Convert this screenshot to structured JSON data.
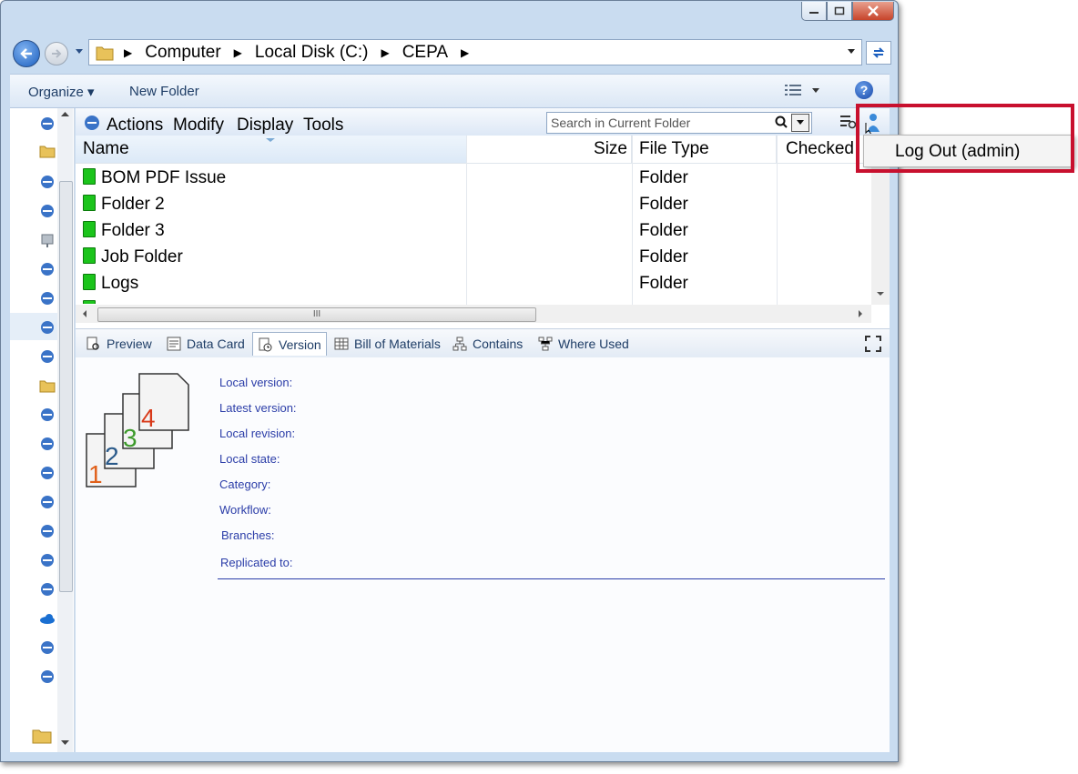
{
  "address": {
    "crumbs": [
      "Computer",
      "Local Disk (C:)",
      "CEPA"
    ]
  },
  "commandbar": {
    "organize": "Organize",
    "new_folder": "New Folder"
  },
  "menu": {
    "actions": "Actions",
    "modify": "Modify",
    "display": "Display",
    "tools": "Tools"
  },
  "search": {
    "placeholder": "Search in Current Folder"
  },
  "columns": {
    "name": "Name",
    "size": "Size",
    "file_type": "File Type",
    "checked": "Checked"
  },
  "files": [
    {
      "name": "BOM PDF Issue",
      "type": "Folder"
    },
    {
      "name": "Folder 2",
      "type": "Folder"
    },
    {
      "name": "Folder 3",
      "type": "Folder"
    },
    {
      "name": "Job Folder",
      "type": "Folder"
    },
    {
      "name": "Logs",
      "type": "Folder"
    }
  ],
  "scrollbar_grip": "III",
  "tabs": [
    {
      "label": "Preview",
      "icon": "eye-icon"
    },
    {
      "label": "Data Card",
      "icon": "data-card-icon"
    },
    {
      "label": "Version",
      "icon": "version-icon",
      "selected": true
    },
    {
      "label": "Bill of Materials",
      "icon": "table-icon"
    },
    {
      "label": "Contains",
      "icon": "hierarchy-icon"
    },
    {
      "label": "Where Used",
      "icon": "where-used-icon"
    }
  ],
  "version": {
    "illustration_digits": [
      "1",
      "2",
      "3",
      "4"
    ],
    "labels": [
      "Local version:",
      "Latest version:",
      "Local revision:",
      "Local state:",
      "Category:",
      "Workflow:",
      "Branches:",
      "Replicated to:"
    ]
  },
  "popup": {
    "logout": "Log Out (admin)"
  },
  "colors": {
    "folder_green": "#1bc41b",
    "label_blue": "#2b3da8",
    "highlight_red": "#c8102e"
  }
}
